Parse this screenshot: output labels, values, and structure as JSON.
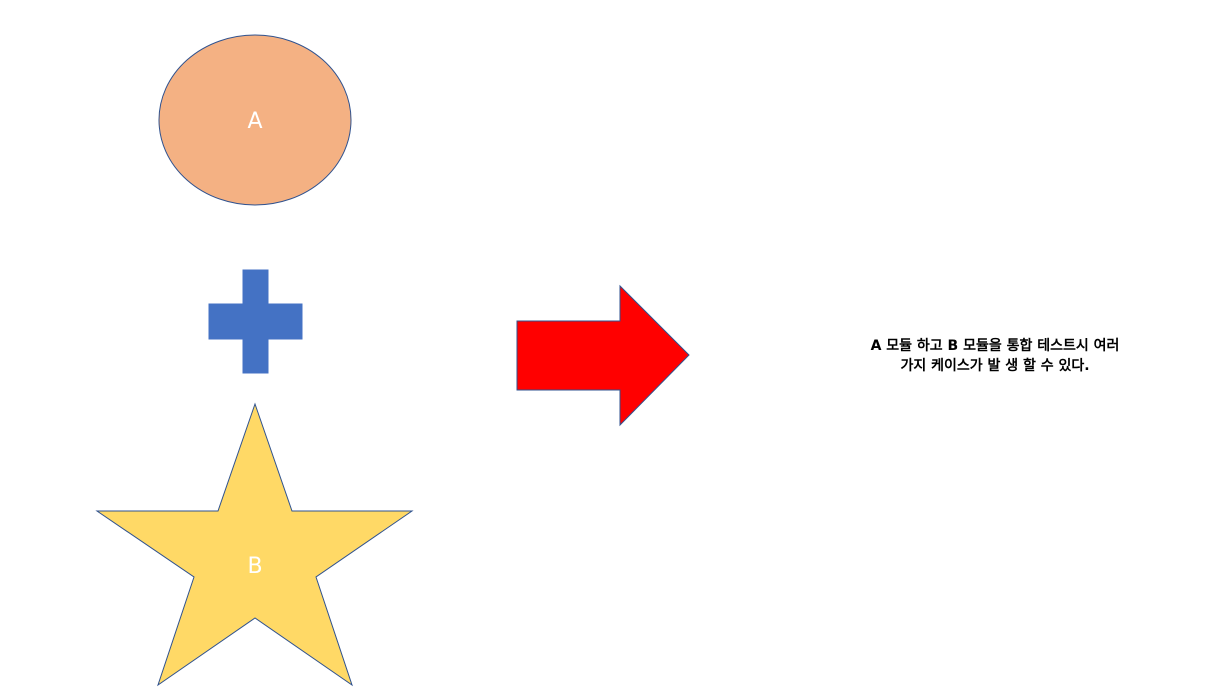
{
  "diagram": {
    "shapes": [
      {
        "id": "module-a",
        "kind": "ellipse",
        "label": "A",
        "fill": "#F4B183",
        "stroke": "#2F528F"
      },
      {
        "id": "plus",
        "kind": "plus",
        "label": "",
        "fill": "#4472C4",
        "stroke": "#4472C4"
      },
      {
        "id": "module-b",
        "kind": "star",
        "label": "B",
        "fill": "#FFD966",
        "stroke": "#2F528F"
      },
      {
        "id": "result-arrow",
        "kind": "right-arrow",
        "label": "",
        "fill": "#FF0000",
        "stroke": "#2F528F"
      }
    ],
    "caption": {
      "line1": "A 모듈 하고 B 모듈을 통합 테스트시 여러",
      "line2": "가지 케이스가 발 생 할 수 있다."
    }
  }
}
